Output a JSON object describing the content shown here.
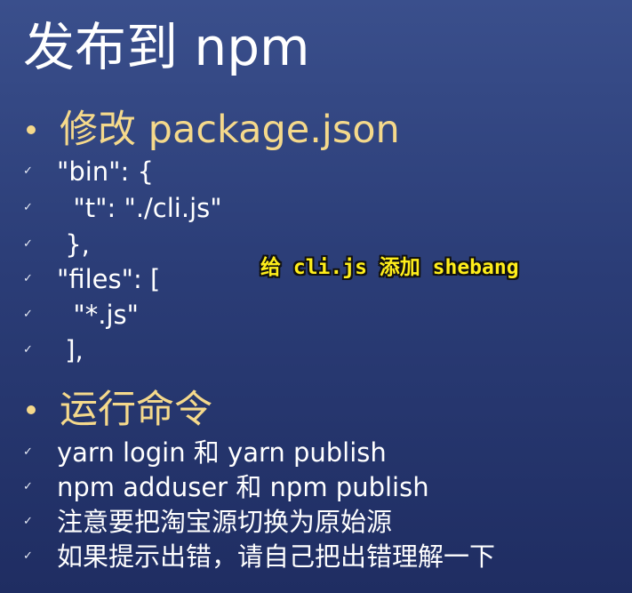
{
  "title": "发布到 npm",
  "sections": [
    {
      "heading": "修改 package.json",
      "lines": [
        "\"bin\": {",
        "  \"t\": \"./cli.js\"",
        " },",
        "\"files\": [",
        "  \"*.js\"",
        " ],"
      ]
    },
    {
      "heading": "运行命令",
      "lines": [
        "yarn login 和 yarn publish",
        "npm adduser 和 npm publish",
        "注意要把淘宝源切换为原始源",
        "如果提示出错，请自己把出错理解一下"
      ]
    }
  ],
  "check_glyph": "✓",
  "overlay_note": "给 cli.js 添加 shebang",
  "colors": {
    "background_top": "#3a4f8c",
    "background_bottom": "#1f2d62",
    "heading": "#f5d98b",
    "text": "#ffffff",
    "overlay": "#ffee1a"
  }
}
